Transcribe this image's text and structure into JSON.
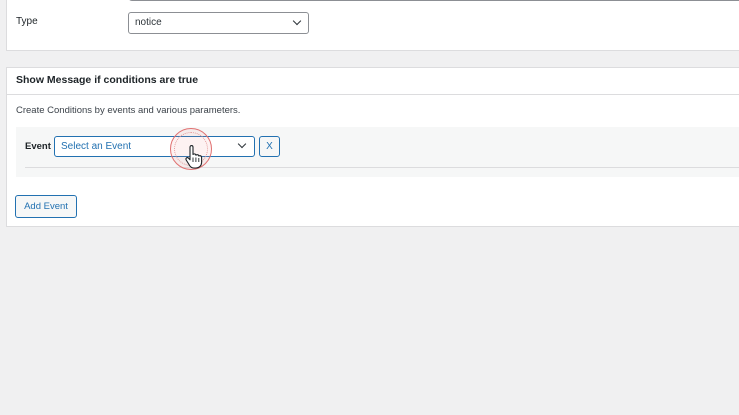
{
  "type_field": {
    "label": "Type",
    "selected": "notice"
  },
  "conditions": {
    "title": "Show Message if conditions are true",
    "description": "Create Conditions by events and various parameters.",
    "event_label": "Event",
    "event_select": {
      "placeholder": "Select an Event"
    },
    "remove_label": "X",
    "add_event_label": "Add Event"
  },
  "colors": {
    "accent": "#2271b1",
    "background": "#f0f0f1",
    "panel": "#ffffff",
    "click_highlight": "#e07070"
  },
  "cursor": {
    "icon": "hand-pointer-icon"
  }
}
